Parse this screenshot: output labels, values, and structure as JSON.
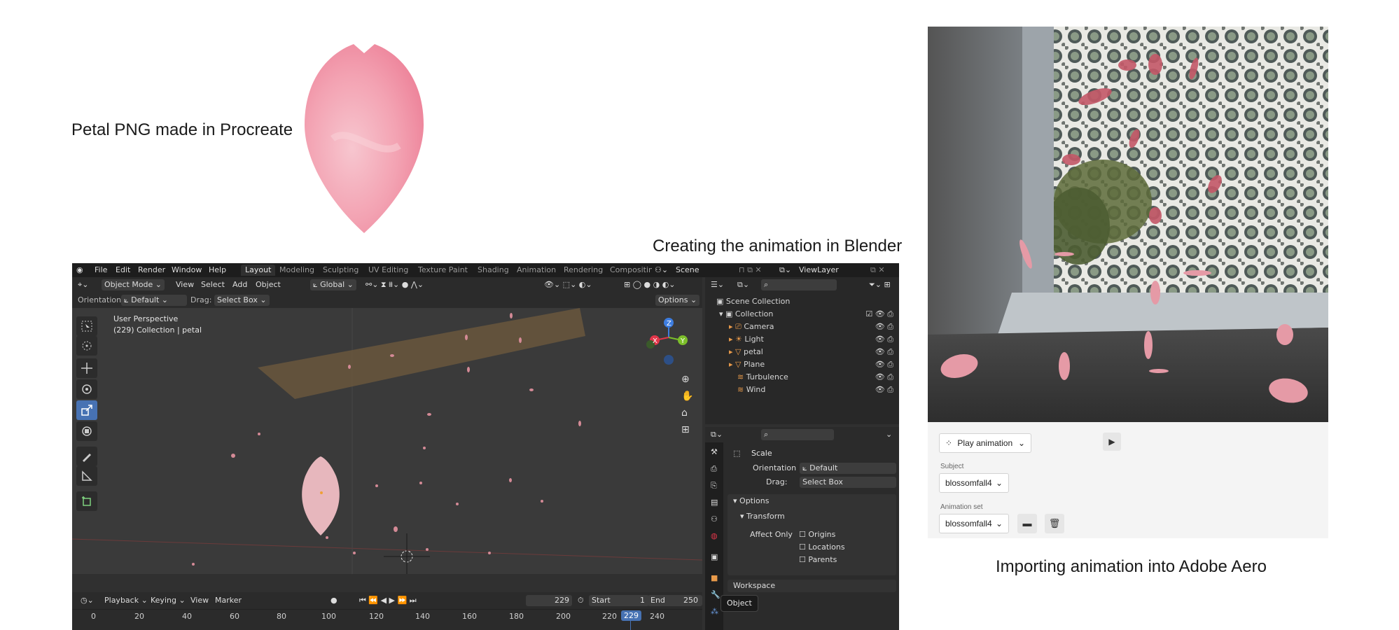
{
  "captions": {
    "petal": "Petal PNG made in Procreate",
    "blender": "Creating the animation in Blender",
    "aero": "Importing animation into Adobe Aero"
  },
  "blender": {
    "menu": [
      "File",
      "Edit",
      "Render",
      "Window",
      "Help"
    ],
    "workspaces": [
      "Layout",
      "Modeling",
      "Sculpting",
      "UV Editing",
      "Texture Paint",
      "Shading",
      "Animation",
      "Rendering",
      "Compositin"
    ],
    "active_workspace": "Layout",
    "scene_name": "Scene",
    "view_layer": "ViewLayer",
    "header": {
      "mode": "Object Mode",
      "view": "View",
      "select": "Select",
      "add": "Add",
      "object": "Object",
      "transform_orientation": "Global"
    },
    "tool_settings": {
      "orientation_label": "Orientation:",
      "orientation_value": "Default",
      "drag_label": "Drag:",
      "drag_value": "Select Box",
      "options": "Options"
    },
    "viewport_info": {
      "perspective": "User Perspective",
      "collection": "(229) Collection | petal"
    },
    "gizmo": {
      "x": "X",
      "y": "Y",
      "z": "Z"
    },
    "outliner": {
      "scene_collection": "Scene Collection",
      "collection": "Collection",
      "items": [
        "Camera",
        "Light",
        "petal",
        "Plane",
        "Turbulence",
        "Wind"
      ]
    },
    "properties": {
      "tool_name": "Scale",
      "orientation_label": "Orientation",
      "orientation_value": "Default",
      "drag_label": "Drag:",
      "drag_value": "Select Box",
      "options_panel": "Options",
      "transform_panel": "Transform",
      "affect_only": "Affect Only",
      "checkboxes": [
        "Origins",
        "Locations",
        "Parents"
      ],
      "workspace_panel": "Workspace",
      "tooltip": "Object"
    },
    "timeline": {
      "playback": "Playback",
      "keying": "Keying",
      "view": "View",
      "marker": "Marker",
      "current_frame": "229",
      "start_label": "Start",
      "start_value": "1",
      "end_label": "End",
      "end_value": "250",
      "frame_ticks": [
        "0",
        "20",
        "40",
        "60",
        "80",
        "100",
        "120",
        "140",
        "160",
        "180",
        "200",
        "220",
        "240"
      ],
      "playhead": "229"
    }
  },
  "aero": {
    "play_button": "Play animation",
    "subject_label": "Subject",
    "subject_value": "blossomfall4",
    "animation_set_label": "Animation set",
    "animation_set_value": "blossomfall4"
  },
  "colors": {
    "blender_active": "#4772b3",
    "petal_pink": "#f08ca0",
    "gizmo_x": "#e2364a",
    "gizmo_y": "#7cbf2a",
    "gizmo_z": "#3d7de0"
  }
}
